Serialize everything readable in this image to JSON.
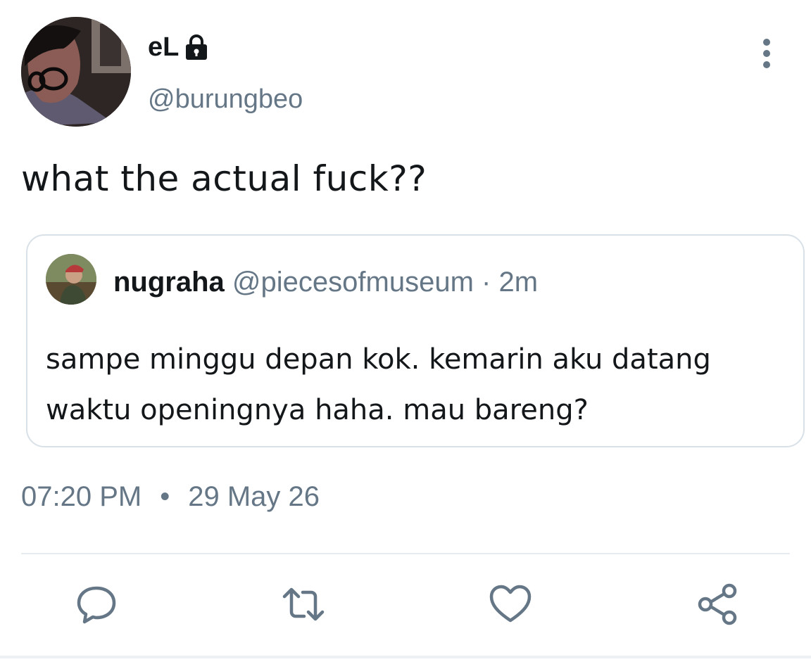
{
  "tweet": {
    "author": {
      "display_name": "eL",
      "handle": "@burungbeo",
      "protected": true
    },
    "text": "what the actual fuck??",
    "quoted": {
      "display_name": "nugraha",
      "handle": "@piecesofmuseum",
      "separator": "·",
      "age": "2m",
      "text": "sampe minggu depan kok. kemarin aku datang waktu openingnya haha. mau bareng?"
    },
    "time": "07:20 PM",
    "time_separator": "•",
    "date": "29 May 26"
  },
  "actions": [
    {
      "name": "reply",
      "icon": "reply-icon"
    },
    {
      "name": "retweet",
      "icon": "retweet-icon"
    },
    {
      "name": "like",
      "icon": "heart-icon"
    },
    {
      "name": "share",
      "icon": "share-icon"
    }
  ],
  "colors": {
    "text_primary": "#14171a",
    "text_secondary": "#657786",
    "border": "#d9e1e8",
    "icon": "#657786"
  }
}
